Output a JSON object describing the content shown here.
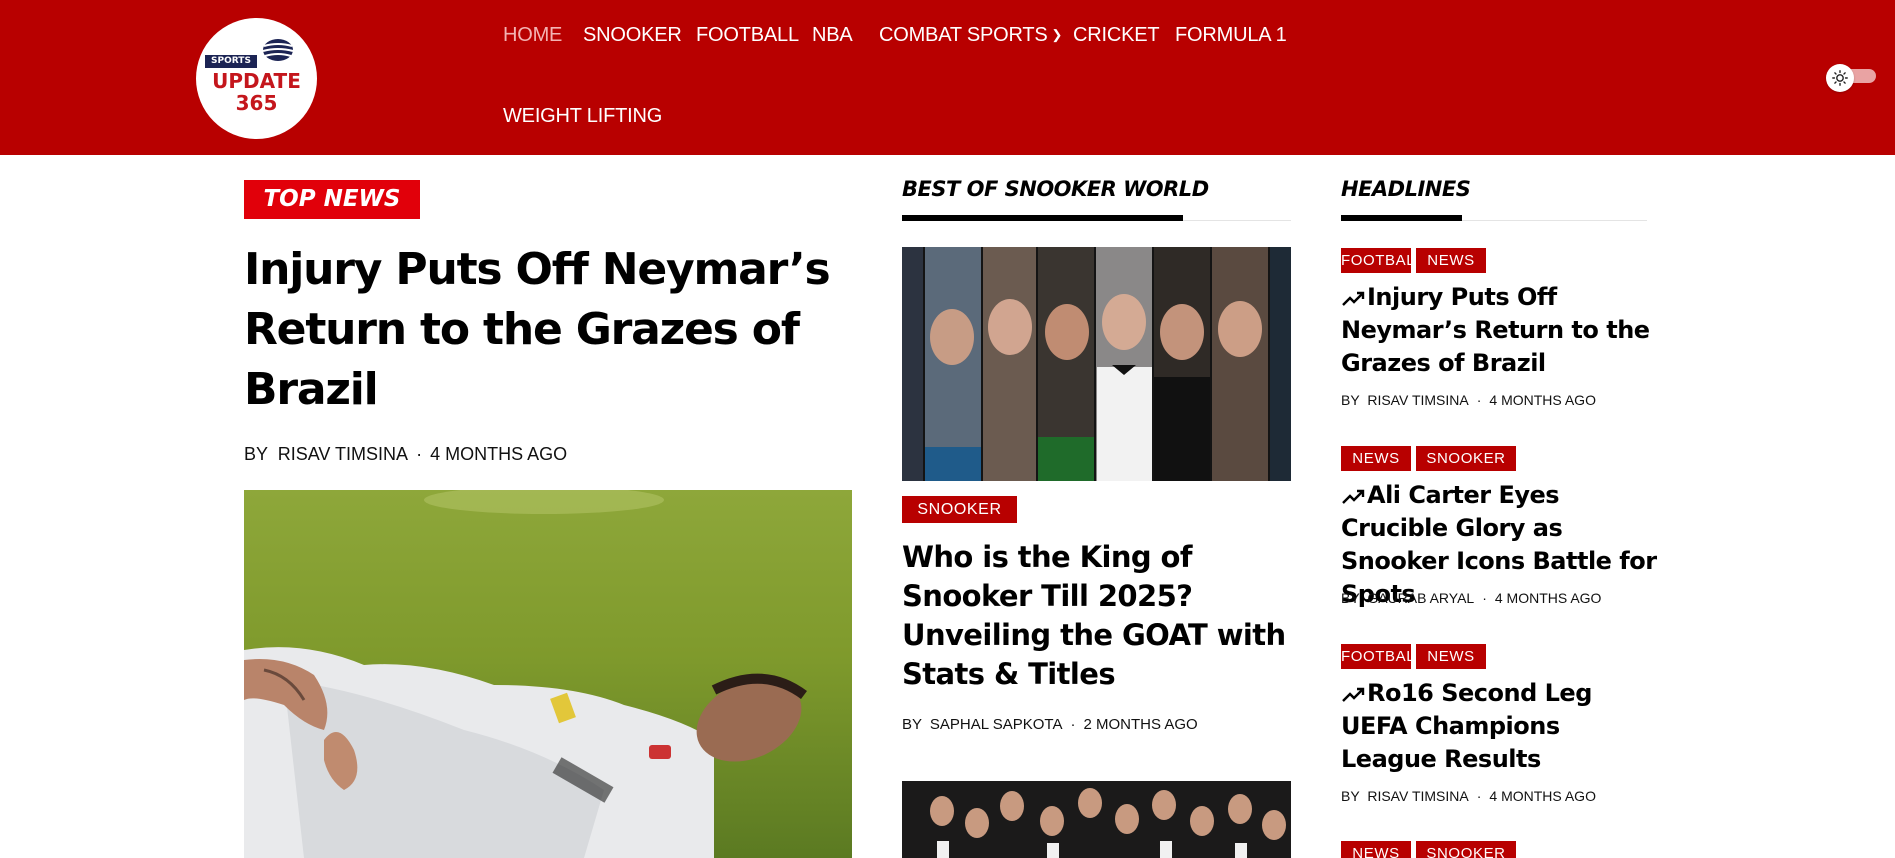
{
  "header": {
    "logo": {
      "line1": "SPORTS",
      "line2": "UPDATE",
      "line3": "365"
    },
    "nav": [
      {
        "label": "HOME"
      },
      {
        "label": "SNOOKER"
      },
      {
        "label": "FOOTBALL"
      },
      {
        "label": "NBA"
      },
      {
        "label": "COMBAT SPORTS"
      },
      {
        "label": "CRICKET"
      },
      {
        "label": "FORMULA 1"
      },
      {
        "label": "WEIGHT LIFTING"
      }
    ],
    "theme_toggle_icon": "sun-icon",
    "colors": {
      "brand": "#b80000",
      "badge_red": "#e1000a",
      "nav_active": "#f3b3b3"
    }
  },
  "top_news": {
    "badge": "TOP NEWS",
    "title": "Injury Puts Off Neymar’s Return to the Grazes of Brazil",
    "by": "BY",
    "author": "RISAV TIMSINA",
    "time": "4 MONTHS AGO"
  },
  "best_of_snooker": {
    "heading": "BEST OF SNOOKER WORLD",
    "article": {
      "category": "SNOOKER",
      "title": "Who is the King of Snooker Till 2025? Unveiling the GOAT with Stats & Titles",
      "by": "BY",
      "author": "SAPHAL SAPKOTA",
      "time": "2 MONTHS AGO"
    }
  },
  "headlines": {
    "heading": "HEADLINES",
    "items": [
      {
        "tags": [
          "FOOTBALL",
          "NEWS"
        ],
        "title": "Injury Puts Off Neymar’s Return to the Grazes of Brazil",
        "by": "BY",
        "author": "RISAV TIMSINA",
        "time": "4 MONTHS AGO"
      },
      {
        "tags": [
          "NEWS",
          "SNOOKER"
        ],
        "title": "Ali Carter Eyes Crucible Glory as Snooker Icons Battle for Spots",
        "by": "BY",
        "author": "GAURAB ARYAL",
        "time": "4 MONTHS AGO"
      },
      {
        "tags": [
          "FOOTBALL",
          "NEWS"
        ],
        "title": "Ro16 Second Leg UEFA Champions League Results",
        "by": "BY",
        "author": "RISAV TIMSINA",
        "time": "4 MONTHS AGO"
      },
      {
        "tags": [
          "NEWS",
          "SNOOKER"
        ]
      }
    ]
  }
}
